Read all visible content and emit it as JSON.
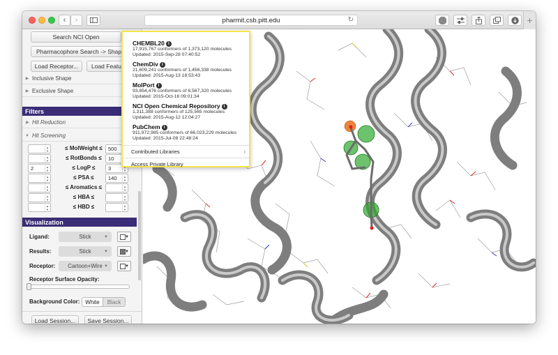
{
  "browser": {
    "url": "pharmit.csb.pitt.edu",
    "back_icon": "‹",
    "forward_icon": "›",
    "reload_icon": "↻",
    "new_tab_icon": "+"
  },
  "sidebar": {
    "search_button": "Search NCI Open",
    "pharmacophore_button": "Pharmacophore Search -> Shape (",
    "load_receptor_button": "Load Receptor...",
    "load_features_button": "Load Featur",
    "inclusive_shape": "Inclusive Shape",
    "exclusive_shape": "Exclusive Shape",
    "filters_header": "Filters",
    "hit_reduction": "Hit Reduction",
    "hit_screening": "Hit Screening",
    "filters": [
      {
        "min": "",
        "label": "≤ MolWeight ≤",
        "max": "500"
      },
      {
        "min": "",
        "label": "≤ RotBonds ≤",
        "max": "10"
      },
      {
        "min": "2",
        "label": "≤ LogP ≤",
        "max": "3"
      },
      {
        "min": "",
        "label": "≤ PSA ≤",
        "max": "140"
      },
      {
        "min": "",
        "label": "≤ Aromatics ≤",
        "max": ""
      },
      {
        "min": "",
        "label": "≤ HBA ≤",
        "max": ""
      },
      {
        "min": "",
        "label": "≤ HBD ≤",
        "max": ""
      }
    ],
    "visualization_header": "Visualization",
    "vis_rows": [
      {
        "label": "Ligand:",
        "value": "Stick",
        "swatch": "#ffffff"
      },
      {
        "label": "Results:",
        "value": "Stick",
        "swatch": "#777777"
      },
      {
        "label": "Receptor:",
        "value": "Cartoon+Wire",
        "swatch": "#ffffff"
      }
    ],
    "opacity_label": "Receptor Surface Opacity:",
    "bg_label": "Background Color:",
    "bg_white": "White",
    "bg_black": "Black",
    "load_session": "Load Session...",
    "save_session": "Save Session..."
  },
  "popup": {
    "libraries": [
      {
        "name": "CHEMBL20",
        "count": "17,915,767 conformers of 1,373,120 molecules",
        "updated": "Updated: 2015-Sep-28 07:40:52"
      },
      {
        "name": "ChemDiv",
        "count": "21,609,241 conformers of 1,456,338 molecules",
        "updated": "Updated: 2015-Aug-13 18:53:43"
      },
      {
        "name": "MolPort",
        "count": "93,854,476 conformers of 6,567,320 molecules",
        "updated": "Updated: 2015-Oct-16 09:01:34"
      },
      {
        "name": "NCI Open Chemical Repository",
        "count": "1,311,388 conformers of 125,565 molecules",
        "updated": "Updated: 2015-Aug-12 12:04:27"
      },
      {
        "name": "PubChem",
        "count": "911,972,985 conformers of 66,023,229 molecules",
        "updated": "Updated: 2015-Jul-08 22:48:24"
      }
    ],
    "contributed": "Contributed Libraries",
    "private": "Access Private Library"
  },
  "colors": {
    "header_bg": "#3a2c76",
    "popup_border": "#f5e34b",
    "ribbon": "#8a8a8a"
  }
}
